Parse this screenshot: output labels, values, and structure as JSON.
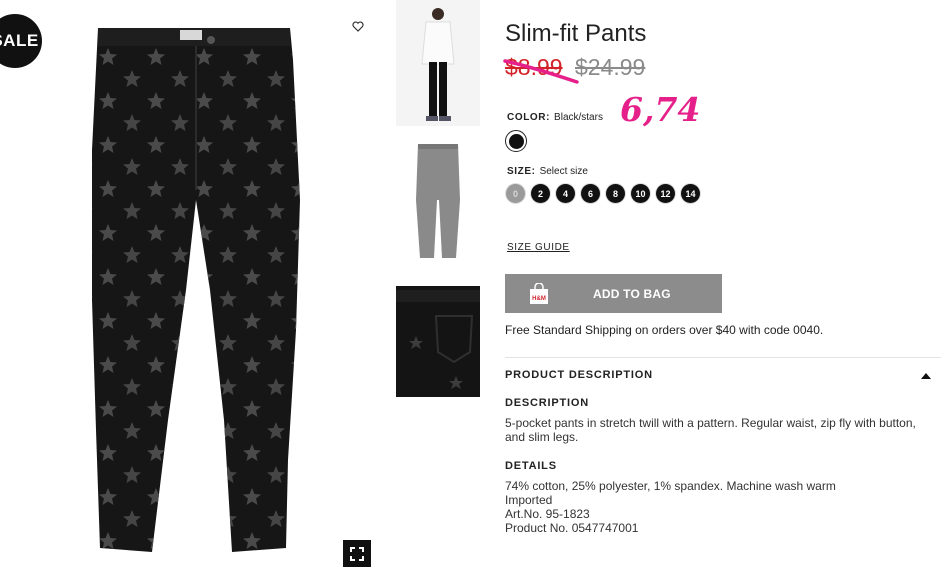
{
  "badge": {
    "sale": "SALE"
  },
  "product": {
    "title": "Slim-fit Pants",
    "price_sale": "$8.99",
    "price_original": "$24.99",
    "handwritten_note": "6,74"
  },
  "color": {
    "label": "COLOR:",
    "value": "Black/stars",
    "swatch_hex": "#111111"
  },
  "size": {
    "label": "SIZE:",
    "value": "Select size",
    "options": [
      "0",
      "2",
      "4",
      "6",
      "8",
      "10",
      "12",
      "14"
    ],
    "unavailable": [
      "0"
    ]
  },
  "size_guide": "SIZE GUIDE",
  "add_to_bag": {
    "label": "ADD TO BAG",
    "icon_text": "H&M"
  },
  "shipping": "Free Standard Shipping on orders over $40 with code 0040.",
  "product_description": {
    "heading": "PRODUCT DESCRIPTION",
    "description_heading": "DESCRIPTION",
    "description_text": "5-pocket pants in stretch twill with a pattern. Regular waist, zip fly with button, and slim legs.",
    "details_heading": "DETAILS",
    "details_lines": [
      "74% cotton, 25% polyester, 1% spandex. Machine wash warm",
      "Imported",
      "Art.No. 95-1823",
      "Product No. 0547747001"
    ]
  },
  "colors": {
    "sale_red": "#d2232a",
    "note_pink": "#e6208a",
    "button_gray": "#8c8c8c"
  },
  "icons": [
    "heart-icon",
    "fullscreen-icon",
    "bag-icon",
    "chevron-up-icon"
  ]
}
